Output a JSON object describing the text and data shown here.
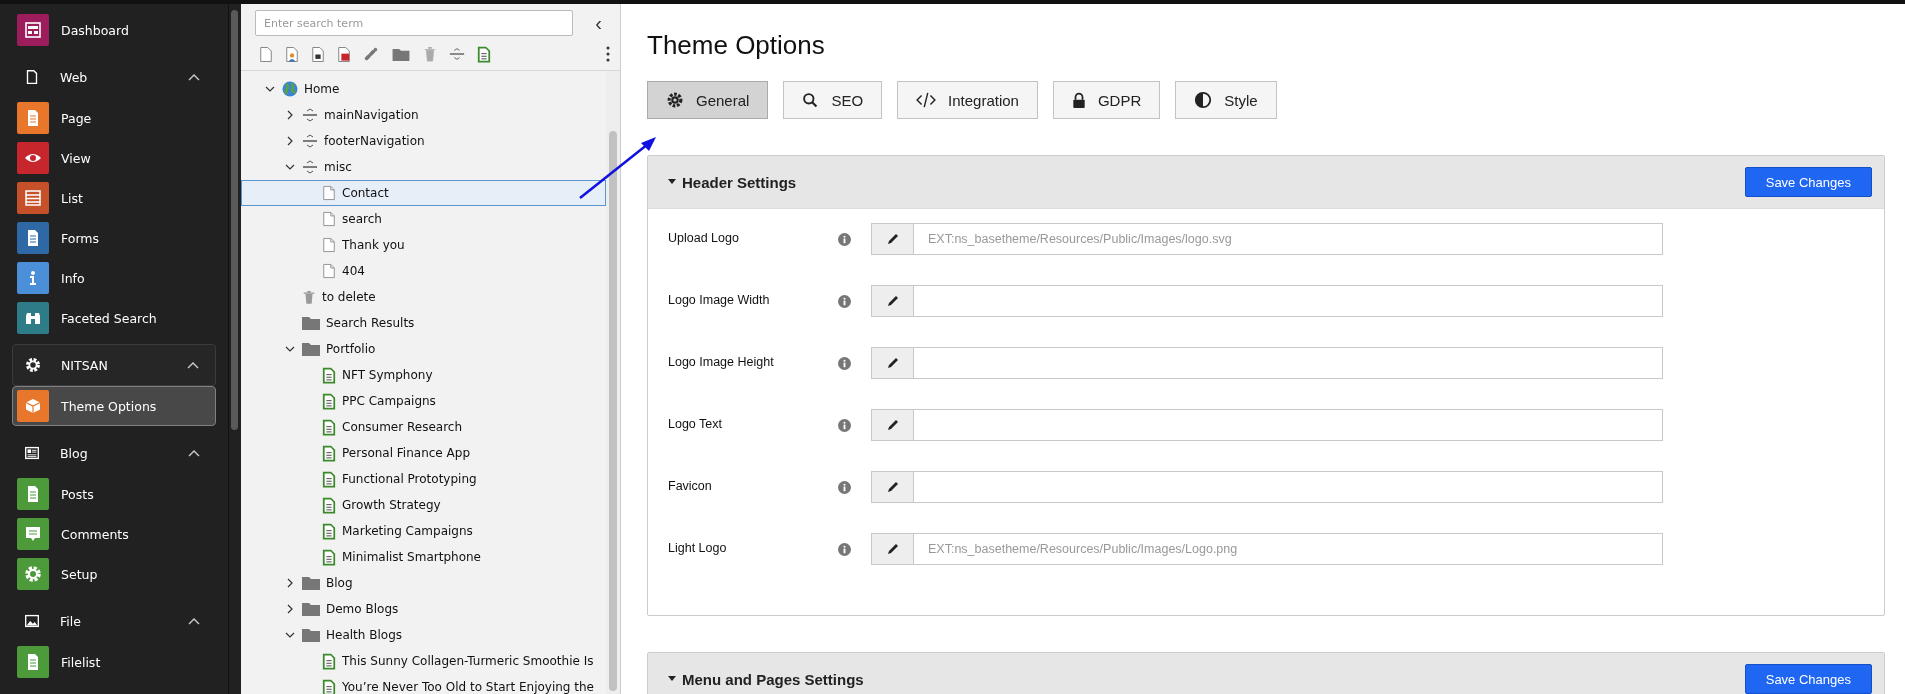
{
  "sidebar": [
    {
      "kind": "module",
      "label": "Dashboard",
      "color": "#9c1c5c",
      "selected": false
    },
    {
      "kind": "group",
      "label": "Web",
      "expanded": true,
      "items": [
        {
          "label": "Page",
          "color": "#e8772b",
          "selected": false
        },
        {
          "label": "View",
          "color": "#c8262d",
          "selected": false
        },
        {
          "label": "List",
          "color": "#c5502a",
          "selected": false
        },
        {
          "label": "Forms",
          "color": "#2f69a5",
          "selected": false
        },
        {
          "label": "Info",
          "color": "#4a8fd8",
          "selected": false
        },
        {
          "label": "Faceted Search",
          "color": "#2d7c88",
          "selected": false
        }
      ]
    },
    {
      "kind": "group",
      "label": "NITSAN",
      "expanded": true,
      "items": [
        {
          "label": "Theme Options",
          "color": "#e8772b",
          "selected": true
        }
      ]
    },
    {
      "kind": "group",
      "label": "Blog",
      "expanded": true,
      "items": [
        {
          "label": "Posts",
          "color": "#4c9a3a",
          "selected": false
        },
        {
          "label": "Comments",
          "color": "#4c9a3a",
          "selected": false
        },
        {
          "label": "Setup",
          "color": "#4c9a3a",
          "selected": false
        }
      ]
    },
    {
      "kind": "group",
      "label": "File",
      "expanded": true,
      "items": [
        {
          "label": "Filelist",
          "color": "#4c9a3a",
          "selected": false
        }
      ]
    }
  ],
  "page_tree": {
    "search": {
      "placeholder": "Enter search term"
    },
    "collapse_button": "‹",
    "nodes": [
      {
        "label": "Home",
        "kind": "globe",
        "expanded": true,
        "selected": false,
        "children": [
          {
            "label": "mainNavigation",
            "kind": "separator",
            "expanded": false,
            "selected": false
          },
          {
            "label": "footerNavigation",
            "kind": "separator",
            "expanded": false,
            "selected": false
          },
          {
            "label": "misc",
            "kind": "separator",
            "expanded": true,
            "selected": false,
            "children": [
              {
                "label": "Contact",
                "kind": "page",
                "selected": true
              },
              {
                "label": "search",
                "kind": "page",
                "selected": false
              },
              {
                "label": "Thank you",
                "kind": "page",
                "selected": false
              },
              {
                "label": "404",
                "kind": "page",
                "selected": false
              }
            ]
          },
          {
            "label": "to delete",
            "kind": "trash",
            "selected": false
          },
          {
            "label": "Search Results",
            "kind": "folder",
            "selected": false
          },
          {
            "label": "Portfolio",
            "kind": "folder",
            "expanded": true,
            "selected": false,
            "children": [
              {
                "label": "NFT Symphony",
                "kind": "content",
                "selected": false
              },
              {
                "label": "PPC Campaigns",
                "kind": "content",
                "selected": false
              },
              {
                "label": "Consumer Research",
                "kind": "content",
                "selected": false
              },
              {
                "label": "Personal Finance App",
                "kind": "content",
                "selected": false
              },
              {
                "label": "Functional Prototyping",
                "kind": "content",
                "selected": false
              },
              {
                "label": "Growth Strategy",
                "kind": "content",
                "selected": false
              },
              {
                "label": "Marketing Campaigns",
                "kind": "content",
                "selected": false
              },
              {
                "label": "Minimalist Smartphone",
                "kind": "content",
                "selected": false
              }
            ]
          },
          {
            "label": "Blog",
            "kind": "folder",
            "expanded": false,
            "selected": false
          },
          {
            "label": "Demo Blogs",
            "kind": "folder",
            "expanded": false,
            "selected": false
          },
          {
            "label": "Health Blogs",
            "kind": "folder",
            "expanded": true,
            "selected": false,
            "children": [
              {
                "label": "This Sunny Collagen-Turmeric Smoothie Is",
                "kind": "content",
                "selected": false
              },
              {
                "label": "You’re Never Too Old to Start Enjoying the",
                "kind": "content",
                "selected": false
              }
            ]
          }
        ]
      }
    ]
  },
  "main": {
    "title": "Theme Options",
    "tabs": [
      {
        "label": "General",
        "selected": true
      },
      {
        "label": "SEO",
        "selected": false
      },
      {
        "label": "Integration",
        "selected": false
      },
      {
        "label": "GDPR",
        "selected": false
      },
      {
        "label": "Style",
        "selected": false
      }
    ],
    "panels": [
      {
        "title": "Header Settings",
        "expanded": true,
        "button": "Save Changes",
        "fields": [
          {
            "label": "Upload Logo",
            "placeholder": "EXT:ns_basetheme/Resources/Public/Images/logo.svg"
          },
          {
            "label": "Logo Image Width"
          },
          {
            "label": "Logo Image Height"
          },
          {
            "label": "Logo Text"
          },
          {
            "label": "Favicon"
          },
          {
            "label": "Light Logo",
            "placeholder": "EXT:ns_basetheme/Resources/Public/Images/Logo.png"
          }
        ]
      },
      {
        "title": "Menu and Pages Settings",
        "expanded": true,
        "button": "Save Changes"
      }
    ]
  }
}
